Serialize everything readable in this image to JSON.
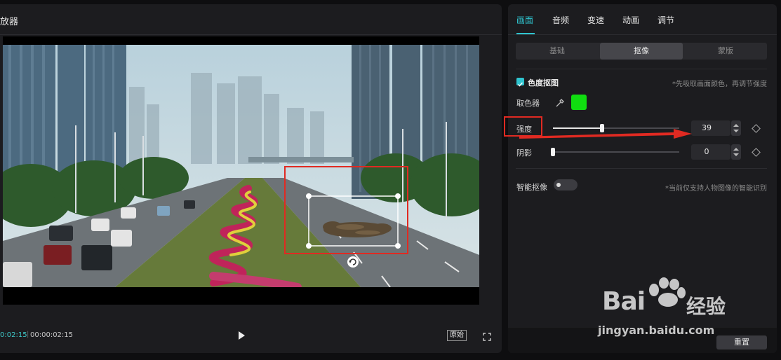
{
  "player": {
    "title": "放器",
    "time_current": "0:02:15",
    "time_total": "00:00:02:15",
    "ratio_label": "原始"
  },
  "props": {
    "tabs": [
      {
        "label": "画面",
        "active": true
      },
      {
        "label": "音频",
        "active": false
      },
      {
        "label": "变速",
        "active": false
      },
      {
        "label": "动画",
        "active": false
      },
      {
        "label": "调节",
        "active": false
      }
    ],
    "segments": [
      {
        "label": "基础",
        "active": false
      },
      {
        "label": "抠像",
        "active": true
      },
      {
        "label": "蒙版",
        "active": false
      }
    ],
    "chroma": {
      "enabled": true,
      "label": "色度抠图",
      "hint": "*先吸取画面颜色，再调节强度",
      "picker_label": "取色器",
      "picked_color": "#10dd10"
    },
    "intensity": {
      "label": "强度",
      "value": "39",
      "fraction": 0.39
    },
    "shadow": {
      "label": "阴影",
      "value": "0",
      "fraction": 0.0
    },
    "smart_cutout": {
      "label": "智能抠像",
      "enabled": false,
      "hint": "*当前仅支持人物图像的智能识别"
    },
    "reset_label": "重置"
  },
  "watermark": {
    "brand": "Bai",
    "brand2": "经验",
    "url": "jingyan.baidu.com"
  },
  "colors": {
    "accent": "#2fc4cf",
    "annotation_red": "#e02a22"
  },
  "icons": {
    "chroma_check": "checkbox-checked-icon",
    "eyedropper": "eyedropper-icon",
    "play": "play-icon",
    "fullscreen": "fullscreen-icon",
    "keyframe": "diamond-keyframe-icon",
    "rotate": "rotate-icon",
    "paw": "paw-icon"
  }
}
